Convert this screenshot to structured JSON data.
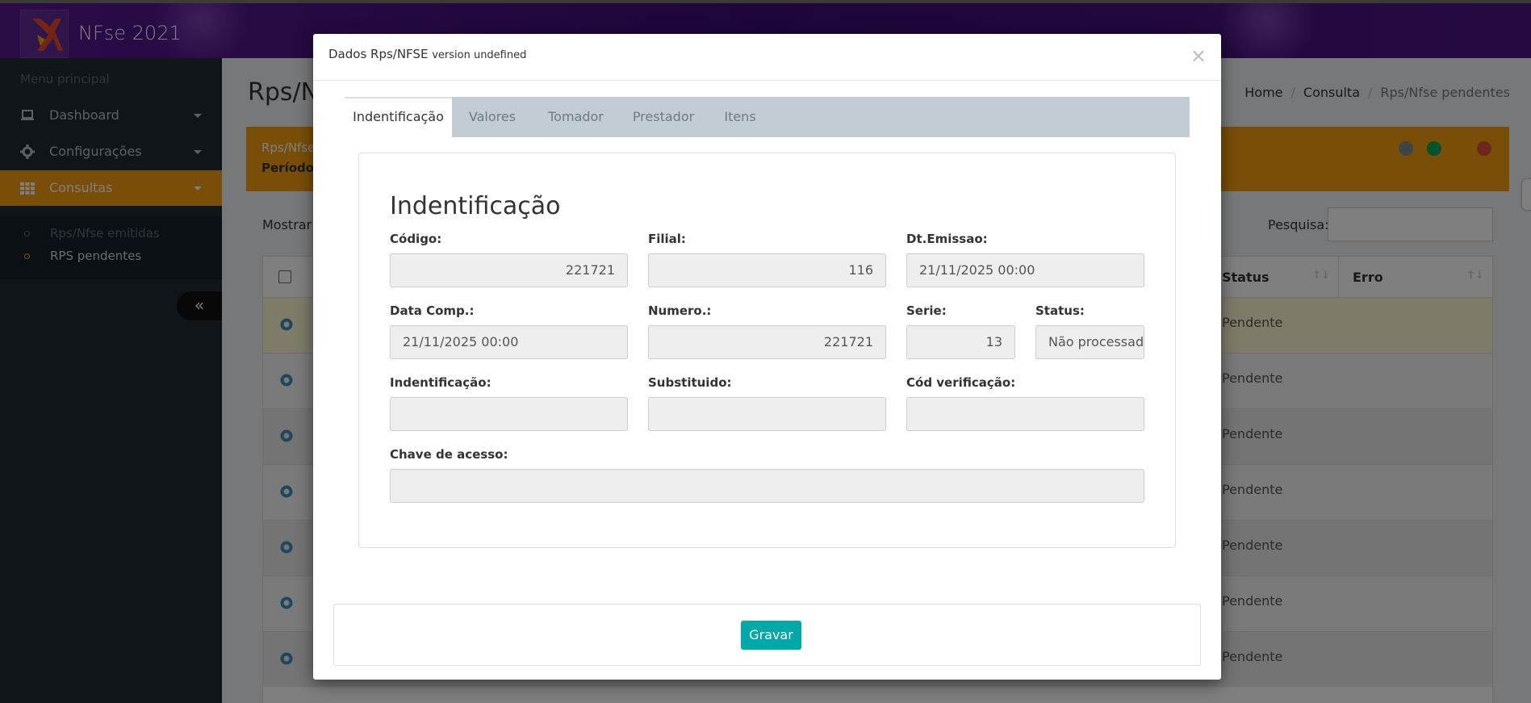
{
  "app": {
    "title": "NFse 2021"
  },
  "sidebar": {
    "menu_header": "Menu principal",
    "items": [
      {
        "label": "Dashboard",
        "icon": "laptop-icon"
      },
      {
        "label": "Configurações",
        "icon": "gear-icon"
      },
      {
        "label": "Consultas",
        "icon": "grid-icon"
      }
    ],
    "subitems": [
      {
        "label": "Rps/Nfse emitidas"
      },
      {
        "label": "RPS pendentes"
      }
    ],
    "collapse_label": "«"
  },
  "page": {
    "title": "Rps/N",
    "breadcrumb": [
      "Home",
      "Consulta",
      "Rps/Nfse pendentes"
    ],
    "panel_title": "Rps/Nfse",
    "panel_period": "Período:",
    "show_label": "Mostrar",
    "search_label": "Pesquisa:",
    "table": {
      "headers": [
        "Status",
        "Erro"
      ],
      "rows": [
        {
          "status": "Pendente"
        },
        {
          "status": "Pendente"
        },
        {
          "status": "Pendente"
        },
        {
          "status": "Pendente"
        },
        {
          "status": "Pendente"
        },
        {
          "status": "Pendente"
        },
        {
          "status": "Pendente"
        }
      ]
    }
  },
  "modal": {
    "title": "Dados Rps/NFSE",
    "version": "version undefined",
    "close_label": "×",
    "tabs": [
      "Indentificação",
      "Valores",
      "Tomador",
      "Prestador",
      "Itens"
    ],
    "section_title": "Indentificação",
    "fields": {
      "codigo": {
        "label": "Código:",
        "value": "221721"
      },
      "filial": {
        "label": "Filial:",
        "value": "116"
      },
      "dt_emissao": {
        "label": "Dt.Emissao:",
        "value": "21/11/2025 00:00"
      },
      "data_comp": {
        "label": "Data Comp.:",
        "value": "21/11/2025 00:00"
      },
      "numero": {
        "label": "Numero.:",
        "value": "221721"
      },
      "serie": {
        "label": "Serie:",
        "value": "13"
      },
      "status": {
        "label": "Status:",
        "value": "Não processada"
      },
      "indentificacao": {
        "label": "Indentificação:",
        "value": ""
      },
      "substituido": {
        "label": "Substituido:",
        "value": ""
      },
      "cod_verificacao": {
        "label": "Cód verificação:",
        "value": ""
      },
      "chave_acesso": {
        "label": "Chave de acesso:",
        "value": ""
      }
    },
    "save_label": "Gravar"
  },
  "colors": {
    "topbar": "#4b1585",
    "sidebar": "#1f2a30",
    "accent_orange": "#f39c12",
    "save_button": "#00a8a8",
    "tab_bar": "#c1ccd3"
  }
}
